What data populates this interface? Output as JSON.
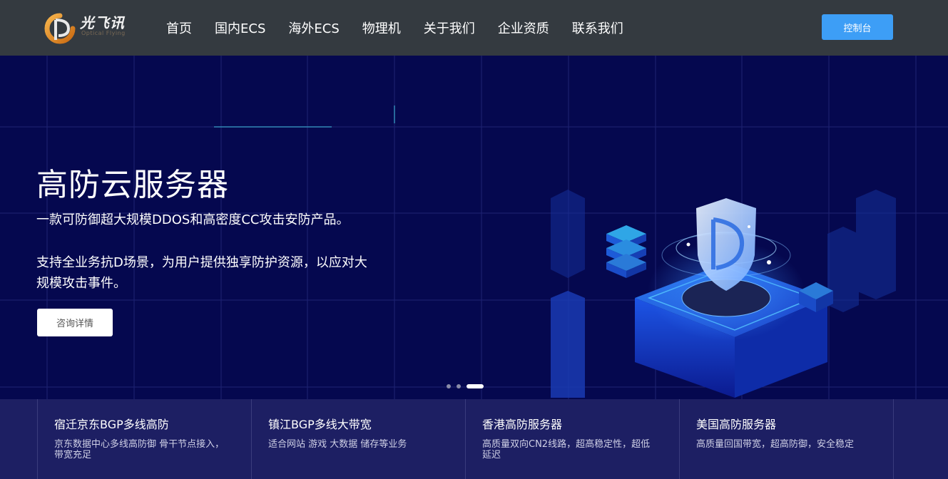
{
  "header": {
    "brand": "光飞讯",
    "brand_sub": "Optical Flying",
    "nav": [
      "首页",
      "国内ECS",
      "海外ECS",
      "物理机",
      "关于我们",
      "企业资质",
      "联系我们"
    ],
    "console_label": "控制台"
  },
  "hero": {
    "title": "高防云服务器",
    "desc1": "一款可防御超大规模DDOS和高密度CC攻击安防产品。",
    "desc2": "支持全业务抗D场景，为用户提供独享防护资源，以应对大规模攻击事件。",
    "button_label": "咨询详情",
    "slide_count": 3,
    "active_slide": 3
  },
  "features": [
    {
      "title": "宿迁京东BGP多线高防",
      "desc": "京东数据中心多线高防御 骨干节点接入，带宽充足"
    },
    {
      "title": "镇江BGP多线大带宽",
      "desc": "适合网站 游戏 大数据 储存等业务"
    },
    {
      "title": "香港高防服务器",
      "desc": "高质量双向CN2线路，超高稳定性，超低延迟"
    },
    {
      "title": "美国高防服务器",
      "desc": "高质量回国带宽，超高防御，安全稳定"
    }
  ],
  "colors": {
    "header_bg": "#343a40",
    "hero_bg": "#05084f",
    "accent": "#3d9ef6",
    "features_bg": "#1d1f63"
  }
}
